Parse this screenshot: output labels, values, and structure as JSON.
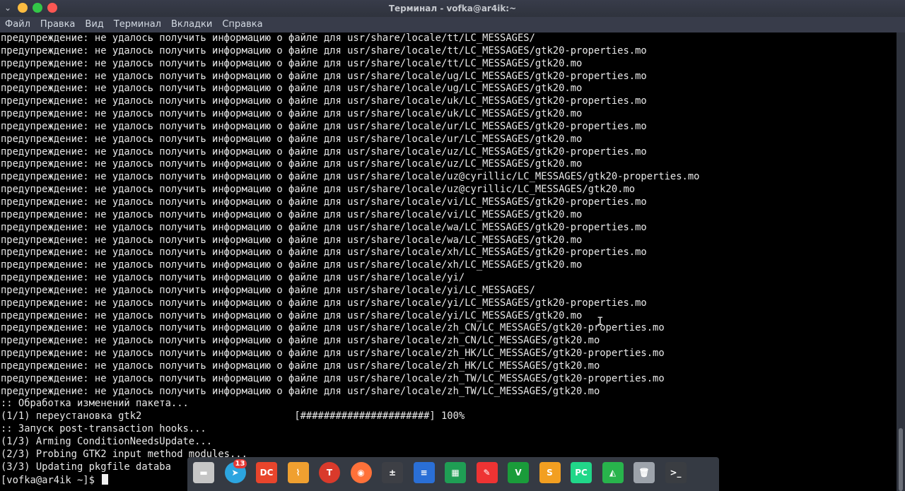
{
  "window": {
    "title": "Терминал - vofka@ar4ik:~",
    "colors": {
      "close": "#fc5753",
      "minimize": "#fdbc40",
      "maximize": "#33c748"
    }
  },
  "menu": [
    "Файл",
    "Правка",
    "Вид",
    "Терминал",
    "Вкладки",
    "Справка"
  ],
  "terminal": {
    "lines": [
      "предупреждение: не удалось получить информацию о файле для usr/share/locale/tt/LC_MESSAGES/",
      "предупреждение: не удалось получить информацию о файле для usr/share/locale/tt/LC_MESSAGES/gtk20-properties.mo",
      "предупреждение: не удалось получить информацию о файле для usr/share/locale/tt/LC_MESSAGES/gtk20.mo",
      "предупреждение: не удалось получить информацию о файле для usr/share/locale/ug/LC_MESSAGES/gtk20-properties.mo",
      "предупреждение: не удалось получить информацию о файле для usr/share/locale/ug/LC_MESSAGES/gtk20.mo",
      "предупреждение: не удалось получить информацию о файле для usr/share/locale/uk/LC_MESSAGES/gtk20-properties.mo",
      "предупреждение: не удалось получить информацию о файле для usr/share/locale/uk/LC_MESSAGES/gtk20.mo",
      "предупреждение: не удалось получить информацию о файле для usr/share/locale/ur/LC_MESSAGES/gtk20-properties.mo",
      "предупреждение: не удалось получить информацию о файле для usr/share/locale/ur/LC_MESSAGES/gtk20.mo",
      "предупреждение: не удалось получить информацию о файле для usr/share/locale/uz/LC_MESSAGES/gtk20-properties.mo",
      "предупреждение: не удалось получить информацию о файле для usr/share/locale/uz/LC_MESSAGES/gtk20.mo",
      "предупреждение: не удалось получить информацию о файле для usr/share/locale/uz@cyrillic/LC_MESSAGES/gtk20-properties.mo",
      "предупреждение: не удалось получить информацию о файле для usr/share/locale/uz@cyrillic/LC_MESSAGES/gtk20.mo",
      "предупреждение: не удалось получить информацию о файле для usr/share/locale/vi/LC_MESSAGES/gtk20-properties.mo",
      "предупреждение: не удалось получить информацию о файле для usr/share/locale/vi/LC_MESSAGES/gtk20.mo",
      "предупреждение: не удалось получить информацию о файле для usr/share/locale/wa/LC_MESSAGES/gtk20-properties.mo",
      "предупреждение: не удалось получить информацию о файле для usr/share/locale/wa/LC_MESSAGES/gtk20.mo",
      "предупреждение: не удалось получить информацию о файле для usr/share/locale/xh/LC_MESSAGES/gtk20-properties.mo",
      "предупреждение: не удалось получить информацию о файле для usr/share/locale/xh/LC_MESSAGES/gtk20.mo",
      "предупреждение: не удалось получить информацию о файле для usr/share/locale/yi/",
      "предупреждение: не удалось получить информацию о файле для usr/share/locale/yi/LC_MESSAGES/",
      "предупреждение: не удалось получить информацию о файле для usr/share/locale/yi/LC_MESSAGES/gtk20-properties.mo",
      "предупреждение: не удалось получить информацию о файле для usr/share/locale/yi/LC_MESSAGES/gtk20.mo",
      "предупреждение: не удалось получить информацию о файле для usr/share/locale/zh_CN/LC_MESSAGES/gtk20-properties.mo",
      "предупреждение: не удалось получить информацию о файле для usr/share/locale/zh_CN/LC_MESSAGES/gtk20.mo",
      "предупреждение: не удалось получить информацию о файле для usr/share/locale/zh_HK/LC_MESSAGES/gtk20-properties.mo",
      "предупреждение: не удалось получить информацию о файле для usr/share/locale/zh_HK/LC_MESSAGES/gtk20.mo",
      "предупреждение: не удалось получить информацию о файле для usr/share/locale/zh_TW/LC_MESSAGES/gtk20-properties.mo",
      "предупреждение: не удалось получить информацию о файле для usr/share/locale/zh_TW/LC_MESSAGES/gtk20.mo",
      ":: Обработка изменений пакета...",
      "(1/1) переустановка gtk2                          [######################] 100%",
      ":: Запуск post-transaction hooks...",
      "(1/3) Arming ConditionNeedsUpdate...",
      "(2/3) Probing GTK2 input method modules...",
      "(3/3) Updating pkgfile databa"
    ],
    "prompt": "[vofka@ar4ik ~]$ "
  },
  "dock": {
    "items": [
      {
        "name": "notes-icon",
        "color": "#c6c6c6"
      },
      {
        "name": "telegram-icon",
        "color": "#2ca5e0",
        "badge": "13"
      },
      {
        "name": "double-commander-icon",
        "color": "#e8452c"
      },
      {
        "name": "cleaner-broom-icon",
        "color": "#f0a030"
      },
      {
        "name": "transmission-icon",
        "color": "#d93a2b"
      },
      {
        "name": "firefox-icon",
        "color": "#ff7139"
      },
      {
        "name": "calculator-icon",
        "color": "#3d3f45"
      },
      {
        "name": "writer-document-icon",
        "color": "#2a6fd6"
      },
      {
        "name": "calc-spreadsheet-icon",
        "color": "#1f9e54"
      },
      {
        "name": "draw-document-icon",
        "color": "#e33"
      },
      {
        "name": "vim-icon",
        "color": "#1a9c3a"
      },
      {
        "name": "sublime-text-icon",
        "color": "#f29f21"
      },
      {
        "name": "pycharm-icon",
        "color": "#21d789"
      },
      {
        "name": "system-monitor-icon",
        "color": "#28b44c"
      },
      {
        "name": "trash-icon",
        "color": "#9da3ab"
      },
      {
        "name": "terminal-icon",
        "color": "#3a3d42"
      }
    ]
  }
}
